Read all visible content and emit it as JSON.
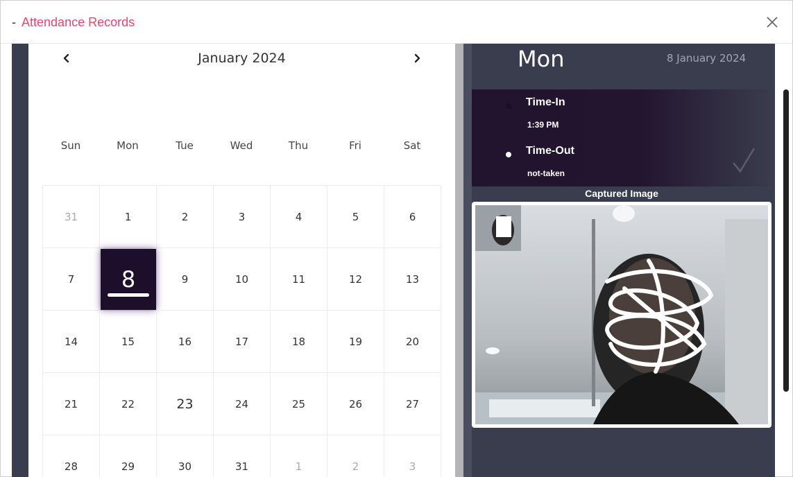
{
  "header": {
    "dash": "-",
    "title": "Attendance Records"
  },
  "calendar": {
    "month_title": "January 2024",
    "weekdays": [
      "Sun",
      "Mon",
      "Tue",
      "Wed",
      "Thu",
      "Fri",
      "Sat"
    ],
    "days": [
      {
        "label": "31",
        "muted": true
      },
      {
        "label": "1"
      },
      {
        "label": "2"
      },
      {
        "label": "3"
      },
      {
        "label": "4"
      },
      {
        "label": "5"
      },
      {
        "label": "6"
      },
      {
        "label": "7"
      },
      {
        "label": "8",
        "selected": true
      },
      {
        "label": "9"
      },
      {
        "label": "10"
      },
      {
        "label": "11"
      },
      {
        "label": "12"
      },
      {
        "label": "13"
      },
      {
        "label": "14"
      },
      {
        "label": "15"
      },
      {
        "label": "16"
      },
      {
        "label": "17"
      },
      {
        "label": "18"
      },
      {
        "label": "19"
      },
      {
        "label": "20"
      },
      {
        "label": "21"
      },
      {
        "label": "22"
      },
      {
        "label": "23",
        "big": true
      },
      {
        "label": "24"
      },
      {
        "label": "25"
      },
      {
        "label": "26"
      },
      {
        "label": "27"
      },
      {
        "label": "28"
      },
      {
        "label": "29"
      },
      {
        "label": "30"
      },
      {
        "label": "31"
      },
      {
        "label": "1",
        "muted": true
      },
      {
        "label": "2",
        "muted": true
      },
      {
        "label": "3",
        "muted": true
      }
    ]
  },
  "detail": {
    "day_name": "Mon",
    "date": "8 January 2024",
    "time_in_label": "Time-In",
    "time_in_value": "1:39 PM",
    "time_out_label": "Time-Out",
    "time_out_value": "not-taken",
    "captured_label": "Captured Image"
  },
  "colors": {
    "accent": "#e8456e",
    "selected_day": "#1d0f2c",
    "panel": "#3a3d4d"
  },
  "icons": [
    "close-icon",
    "chevron-left-icon",
    "chevron-right-icon",
    "checkmark-icon"
  ]
}
